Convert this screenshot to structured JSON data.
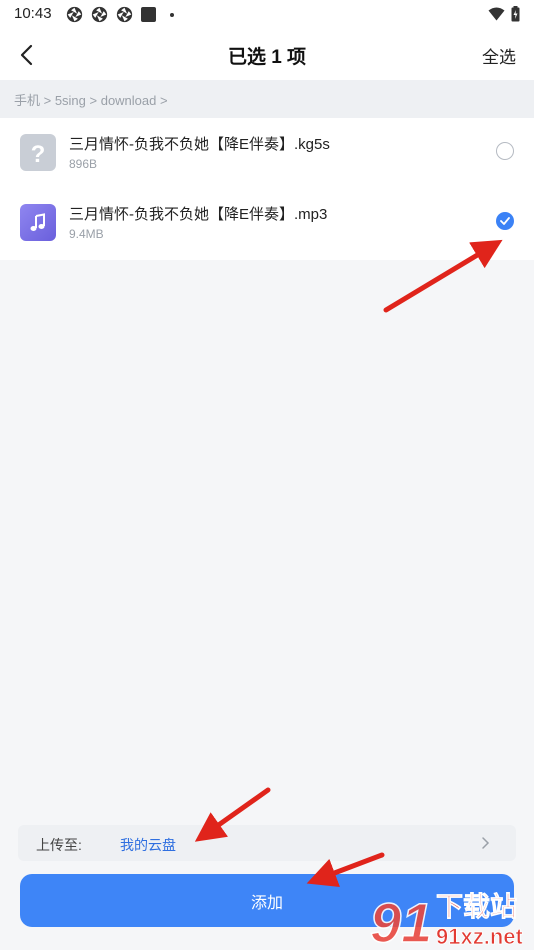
{
  "status_bar": {
    "time": "10:43",
    "left_icons": [
      "aperture-icon",
      "aperture-icon",
      "aperture-icon",
      "square-notification-icon",
      "dot-icon"
    ],
    "right_icons": [
      "wifi-icon",
      "battery-icon"
    ]
  },
  "header": {
    "title": "已选 1 项",
    "select_all": "全选",
    "back_icon": "chevron-left-icon"
  },
  "breadcrumb": {
    "path": "手机 > 5sing > download >"
  },
  "files": [
    {
      "name": "三月情怀-负我不负她【降E伴奏】.kg5s",
      "size": "896B",
      "icon": "unknown-file-icon",
      "selected": false
    },
    {
      "name": "三月情怀-负我不负她【降E伴奏】.mp3",
      "size": "9.4MB",
      "icon": "music-file-icon",
      "selected": true
    }
  ],
  "upload": {
    "label": "上传至:",
    "destination": "我的云盘",
    "chevron_icon": "chevron-right-icon"
  },
  "actions": {
    "add_label": "添加"
  },
  "watermark": {
    "title": "下载站",
    "site": "91xz.net",
    "logo_text": "91"
  },
  "colors": {
    "accent": "#3e85f7",
    "link": "#2f6fe0",
    "annotation": "#e0241b",
    "background": "#f5f6f8"
  }
}
